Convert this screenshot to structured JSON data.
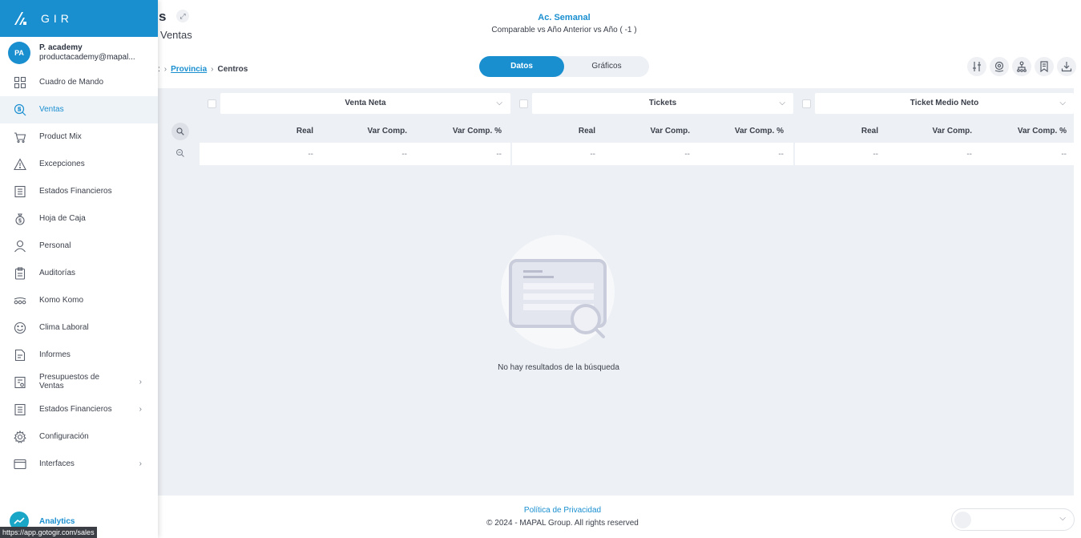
{
  "brand": {
    "name": "GIR"
  },
  "user": {
    "initials": "PA",
    "name": "P. academy",
    "email": "productacademy@mapal..."
  },
  "nav": [
    {
      "label": "Cuadro de Mando",
      "icon": "dashboard-icon",
      "active": false,
      "has_children": false
    },
    {
      "label": "Ventas",
      "icon": "sales-coin-icon",
      "active": true,
      "has_children": false
    },
    {
      "label": "Product Mix",
      "icon": "cart-icon",
      "active": false,
      "has_children": false
    },
    {
      "label": "Excepciones",
      "icon": "warning-icon",
      "active": false,
      "has_children": false
    },
    {
      "label": "Estados Financieros",
      "icon": "financial-report-icon",
      "active": false,
      "has_children": false
    },
    {
      "label": "Hoja de Caja",
      "icon": "money-bag-icon",
      "active": false,
      "has_children": false
    },
    {
      "label": "Personal",
      "icon": "person-icon",
      "active": false,
      "has_children": false
    },
    {
      "label": "Auditorías",
      "icon": "clipboard-icon",
      "active": false,
      "has_children": false
    },
    {
      "label": "Komo Komo",
      "icon": "komo-komo-icon",
      "active": false,
      "has_children": false
    },
    {
      "label": "Clima Laboral",
      "icon": "smiley-icon",
      "active": false,
      "has_children": false
    },
    {
      "label": "Informes",
      "icon": "report-icon",
      "active": false,
      "has_children": false
    },
    {
      "label": "Presupuestos de Ventas",
      "icon": "budget-icon",
      "active": false,
      "has_children": true
    },
    {
      "label": "Estados Financieros",
      "icon": "financial-report-icon",
      "active": false,
      "has_children": true
    },
    {
      "label": "Configuración",
      "icon": "gear-icon",
      "active": false,
      "has_children": false
    },
    {
      "label": "Interfaces",
      "icon": "window-icon",
      "active": false,
      "has_children": true
    }
  ],
  "analytics": {
    "label": "Analytics"
  },
  "status_url": "https://app.gotogir.com/sales",
  "header": {
    "title_fragment": "s",
    "subtitle_fragment": "Ventas",
    "period_title": "Ac. Semanal",
    "period_subtitle": "Comparable vs Año Anterior vs Año ( -1 )"
  },
  "breadcrumb": {
    "lead": ":",
    "link": "Provincia",
    "current": "Centros"
  },
  "view_toggle": {
    "active": "Datos",
    "inactive": "Gráficos"
  },
  "toolbar_icons": [
    "adjust-sliders-icon",
    "location-pin-icon",
    "hierarchy-icon",
    "bookmark-icon",
    "download-icon"
  ],
  "table": {
    "groups": [
      {
        "label": "Venta Neta",
        "columns": [
          "Real",
          "Var Comp.",
          "Var Comp. %"
        ],
        "values": [
          "--",
          "--",
          "--"
        ]
      },
      {
        "label": "Tickets",
        "columns": [
          "Real",
          "Var Comp.",
          "Var Comp. %"
        ],
        "values": [
          "--",
          "--",
          "--"
        ]
      },
      {
        "label": "Ticket Medio Neto",
        "columns": [
          "Real",
          "Var Comp.",
          "Var Comp. %"
        ],
        "values": [
          "--",
          "--",
          "--"
        ]
      }
    ]
  },
  "empty_state": {
    "message": "No hay resultados de la búsqueda"
  },
  "footer": {
    "policy": "Política de Privacidad",
    "copyright": "© 2024 - MAPAL Group. All rights reserved"
  },
  "colors": {
    "accent": "#1a8fd0",
    "panel": "#edf0f4"
  }
}
